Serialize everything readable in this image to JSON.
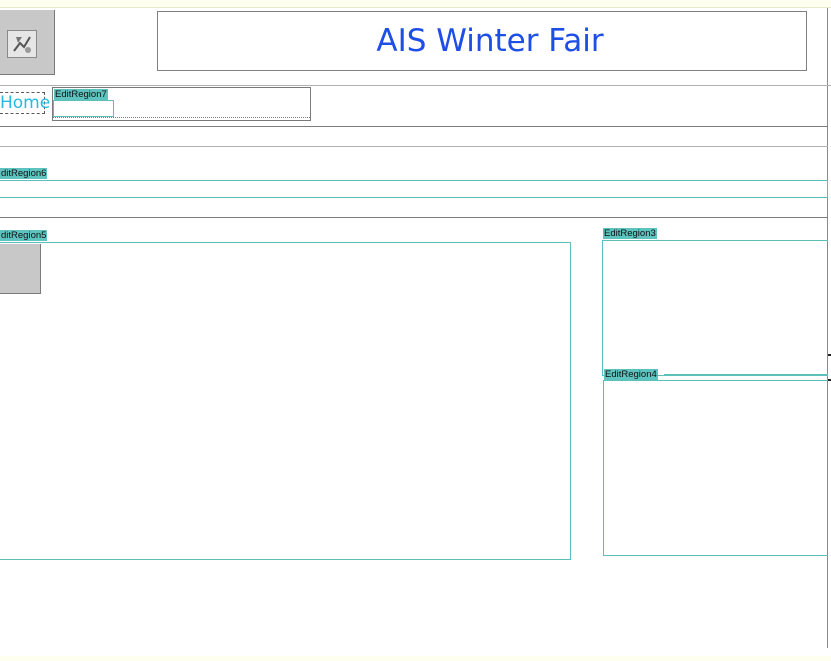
{
  "header": {
    "logo_icon": "broken-image-icon",
    "title": "AIS Winter Fair"
  },
  "nav": {
    "home_link": "Home"
  },
  "regions": {
    "region7": "EditRegion7",
    "region6": "ditRegion6",
    "region5": "ditRegion5",
    "region3": "EditRegion3",
    "region4": "EditRegion4"
  },
  "colors": {
    "title": "#1d4ee6",
    "link": "#29b9e0",
    "region_tab": "#5cc3be",
    "region_border": "#5dbfbb"
  }
}
